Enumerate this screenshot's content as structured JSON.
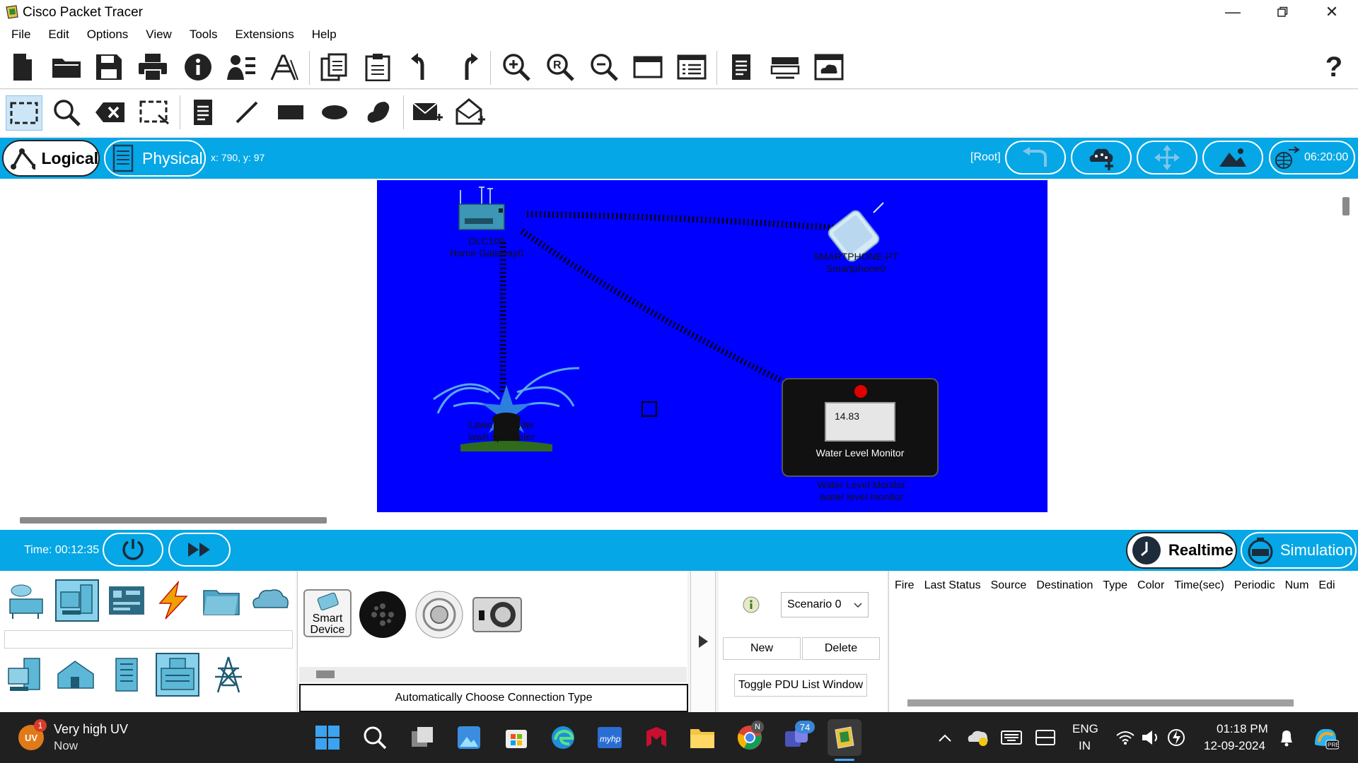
{
  "window": {
    "title": "Cisco Packet Tracer"
  },
  "menu": [
    "File",
    "Edit",
    "Options",
    "View",
    "Tools",
    "Extensions",
    "Help"
  ],
  "modebar": {
    "logical_label": "Logical",
    "physical_label": "Physical",
    "coords": "x: 790, y: 97",
    "root_label": "[Root]",
    "clock": "06:20:00"
  },
  "devices": {
    "gateway": {
      "model": "DLC100",
      "name": "Home Gateway0"
    },
    "smartphone": {
      "model": "SMARTPHONE-PT",
      "name": "Smartphone0"
    },
    "sprinkler": {
      "model": "Lawn Sprinkler",
      "name": "lawn sprinkeler"
    },
    "monitor": {
      "model": "Water Level Monitor",
      "name": "water level monitor",
      "reading": "14.83",
      "screen_label": "Water Level Monitor"
    }
  },
  "sim": {
    "time": "Time: 00:12:35",
    "realtime_label": "Realtime",
    "simulation_label": "Simulation"
  },
  "palette": {
    "smart_device_label": "Smart Device",
    "connection_type": "Automatically Choose Connection Type"
  },
  "scenario": {
    "selected": "Scenario 0",
    "new_label": "New",
    "delete_label": "Delete",
    "toggle_label": "Toggle PDU List Window"
  },
  "pdu_table": {
    "columns": [
      "Fire",
      "Last Status",
      "Source",
      "Destination",
      "Type",
      "Color",
      "Time(sec)",
      "Periodic",
      "Num",
      "Edi"
    ]
  },
  "taskbar": {
    "weather_title": "Very high UV",
    "weather_sub": "Now",
    "weather_badge": "1",
    "teams_badge": "74",
    "chrome_badge": "N",
    "lang": "ENG",
    "region": "IN",
    "time": "01:18 PM",
    "date": "12-09-2024"
  },
  "colors": {
    "accent_blue": "#05a7e6",
    "canvas_blue": "#0000ff"
  }
}
